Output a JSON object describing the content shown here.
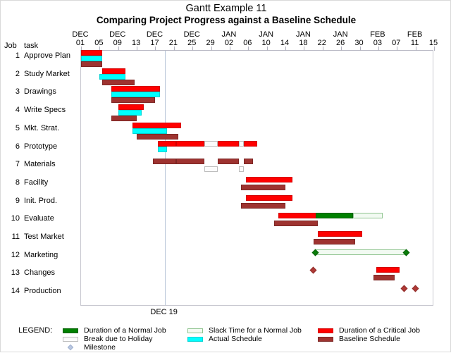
{
  "header": {
    "title": "Gantt Example 11",
    "subtitle": "Comparing Project Progress against a Baseline Schedule",
    "col_job": "Job",
    "col_task": "task"
  },
  "axis": {
    "ticks": [
      {
        "mon": "DEC",
        "day": "01"
      },
      {
        "mon": "",
        "day": "05"
      },
      {
        "mon": "DEC",
        "day": "09"
      },
      {
        "mon": "",
        "day": "13"
      },
      {
        "mon": "DEC",
        "day": "17"
      },
      {
        "mon": "",
        "day": "21"
      },
      {
        "mon": "DEC",
        "day": "25"
      },
      {
        "mon": "",
        "day": "29"
      },
      {
        "mon": "JAN",
        "day": "02"
      },
      {
        "mon": "",
        "day": "06"
      },
      {
        "mon": "JAN",
        "day": "10"
      },
      {
        "mon": "",
        "day": "14"
      },
      {
        "mon": "JAN",
        "day": "18"
      },
      {
        "mon": "",
        "day": "22"
      },
      {
        "mon": "JAN",
        "day": "26"
      },
      {
        "mon": "",
        "day": "30"
      },
      {
        "mon": "FEB",
        "day": "03"
      },
      {
        "mon": "",
        "day": "07"
      },
      {
        "mon": "FEB",
        "day": "11"
      },
      {
        "mon": "",
        "day": "15"
      }
    ],
    "reference_line": {
      "mon": "DEC",
      "day": "19",
      "value": 18
    }
  },
  "colors": {
    "critical": "#ff0000",
    "baseline": "#9e3330",
    "actual": "#00ffff",
    "normal": "#008000",
    "slack_fill": "#f2faf2",
    "slack_border": "#8fc48f",
    "break_fill": "#fbfbfb",
    "milestone_critical": "#b03a36",
    "milestone_normal": "#0a7d0a",
    "reference_line": "#b9c6d8"
  },
  "chart_data": {
    "type": "bar",
    "chart_kind": "gantt",
    "title": "Gantt Example 11",
    "subtitle": "Comparing Project Progress against a Baseline Schedule",
    "xlabel": "",
    "ylabel": "",
    "x_axis_unit": "days",
    "x_start_label": "DEC 01",
    "x_end_label": "FEB 15",
    "xlim": [
      0,
      76
    ],
    "grid": false,
    "legend_position": "bottom",
    "rows": [
      {
        "job": "1",
        "task": "Approve Plan",
        "segments": [
          {
            "series": "critical",
            "start": 0.0,
            "end": 4.5
          },
          {
            "series": "actual",
            "start": 0.0,
            "end": 4.5
          },
          {
            "series": "baseline",
            "start": 0.0,
            "end": 4.5
          }
        ],
        "milestones": []
      },
      {
        "job": "2",
        "task": "Study Market",
        "segments": [
          {
            "series": "critical",
            "start": 4.5,
            "end": 9.5
          },
          {
            "series": "actual",
            "start": 4.0,
            "end": 9.5
          },
          {
            "series": "baseline",
            "start": 4.5,
            "end": 11.5
          }
        ],
        "milestones": []
      },
      {
        "job": "3",
        "task": "Drawings",
        "segments": [
          {
            "series": "critical",
            "start": 6.5,
            "end": 17.0
          },
          {
            "series": "actual",
            "start": 6.5,
            "end": 17.0
          },
          {
            "series": "baseline",
            "start": 6.5,
            "end": 16.0
          }
        ],
        "milestones": []
      },
      {
        "job": "4",
        "task": "Write Specs",
        "segments": [
          {
            "series": "critical",
            "start": 8.0,
            "end": 13.5
          },
          {
            "series": "actual",
            "start": 8.0,
            "end": 13.0
          },
          {
            "series": "baseline",
            "start": 6.5,
            "end": 12.0
          }
        ],
        "milestones": []
      },
      {
        "job": "5",
        "task": "Mkt. Strat.",
        "segments": [
          {
            "series": "critical",
            "start": 11.0,
            "end": 21.5
          },
          {
            "series": "actual",
            "start": 11.0,
            "end": 18.5
          },
          {
            "series": "baseline",
            "start": 12.0,
            "end": 21.0
          }
        ],
        "milestones": []
      },
      {
        "job": "6",
        "task": "Prototype",
        "segments": [
          {
            "series": "critical",
            "start": 16.5,
            "end": 20.5
          },
          {
            "series": "critical",
            "start": 20.5,
            "end": 26.5
          },
          {
            "series": "break",
            "start": 26.5,
            "end": 29.5
          },
          {
            "series": "critical",
            "start": 29.5,
            "end": 34.0
          },
          {
            "series": "break",
            "start": 34.0,
            "end": 35.0
          },
          {
            "series": "critical",
            "start": 35.0,
            "end": 38.0
          },
          {
            "series": "actual",
            "start": 16.5,
            "end": 18.5
          }
        ],
        "milestones": []
      },
      {
        "job": "7",
        "task": "Materials",
        "segments": [
          {
            "series": "baseline",
            "start": 15.5,
            "end": 20.5
          },
          {
            "series": "baseline",
            "start": 20.5,
            "end": 26.5
          },
          {
            "series": "break",
            "start": 26.5,
            "end": 29.5
          },
          {
            "series": "baseline",
            "start": 29.5,
            "end": 34.0
          },
          {
            "series": "break",
            "start": 34.0,
            "end": 35.0
          },
          {
            "series": "baseline",
            "start": 35.0,
            "end": 37.0
          }
        ],
        "milestones": []
      },
      {
        "job": "8",
        "task": "Facility",
        "segments": [
          {
            "series": "critical",
            "start": 35.5,
            "end": 45.5
          },
          {
            "series": "baseline",
            "start": 34.5,
            "end": 44.0
          }
        ],
        "milestones": []
      },
      {
        "job": "9",
        "task": "Init. Prod.",
        "segments": [
          {
            "series": "critical",
            "start": 35.5,
            "end": 45.5
          },
          {
            "series": "baseline",
            "start": 34.5,
            "end": 44.0
          }
        ],
        "milestones": []
      },
      {
        "job": "10",
        "task": "Evaluate",
        "segments": [
          {
            "series": "critical",
            "start": 42.5,
            "end": 52.0
          },
          {
            "series": "baseline",
            "start": 41.5,
            "end": 51.0
          },
          {
            "series": "normal",
            "start": 50.5,
            "end": 58.5
          },
          {
            "series": "slack",
            "start": 58.5,
            "end": 65.0
          }
        ],
        "milestones": []
      },
      {
        "job": "11",
        "task": "Test Market",
        "segments": [
          {
            "series": "critical",
            "start": 51.0,
            "end": 60.5
          },
          {
            "series": "baseline",
            "start": 50.0,
            "end": 59.0
          }
        ],
        "milestones": []
      },
      {
        "job": "12",
        "task": "Marketing",
        "segments": [
          {
            "series": "slack",
            "start": 50.5,
            "end": 70.0
          }
        ],
        "milestones": [
          {
            "series": "normal",
            "at": 50.5
          },
          {
            "series": "normal",
            "at": 70.0
          }
        ]
      },
      {
        "job": "13",
        "task": "Changes",
        "segments": [
          {
            "series": "critical",
            "start": 63.5,
            "end": 68.5
          },
          {
            "series": "baseline",
            "start": 63.0,
            "end": 67.5
          }
        ],
        "milestones": [
          {
            "series": "critical",
            "at": 50.0
          }
        ]
      },
      {
        "job": "14",
        "task": "Production",
        "segments": [],
        "milestones": [
          {
            "series": "critical",
            "at": 69.5
          },
          {
            "series": "critical",
            "at": 72.0
          }
        ]
      }
    ]
  },
  "legend": {
    "title": "LEGEND:",
    "items": [
      {
        "key": "normal",
        "label": "Duration of a Normal Job",
        "col": 0,
        "row": 0
      },
      {
        "key": "brk",
        "label": "Break due to Holiday",
        "col": 0,
        "row": 1
      },
      {
        "key": "ms",
        "label": "Milestone",
        "col": 0,
        "row": 2
      },
      {
        "key": "slack",
        "label": "Slack Time for a Normal Job",
        "col": 1,
        "row": 0
      },
      {
        "key": "actual",
        "label": "Actual Schedule",
        "col": 1,
        "row": 1
      },
      {
        "key": "crit",
        "label": "Duration of a Critical Job",
        "col": 2,
        "row": 0
      },
      {
        "key": "base",
        "label": "Baseline Schedule",
        "col": 2,
        "row": 1
      }
    ]
  }
}
